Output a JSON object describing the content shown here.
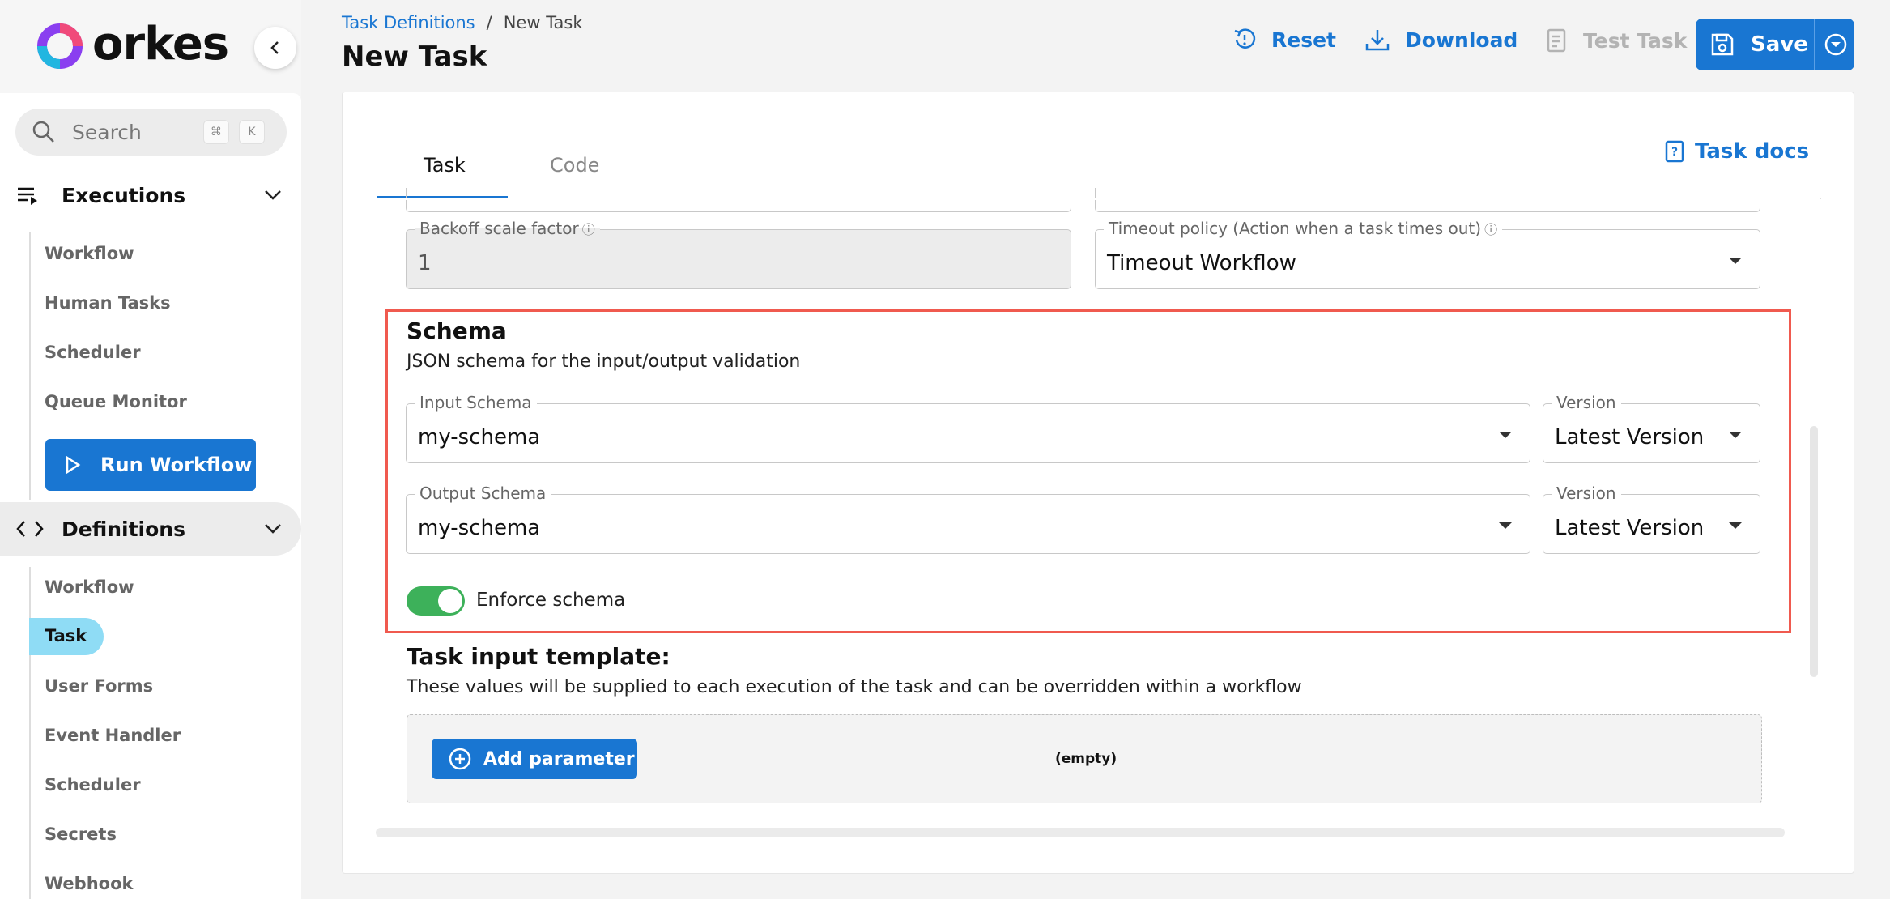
{
  "app": {
    "logo_text": "orkes"
  },
  "sidebar": {
    "search": {
      "placeholder": "Search",
      "kbd_1": "⌘",
      "kbd_2": "K"
    },
    "executions": {
      "label": "Executions",
      "items": [
        "Workflow",
        "Human Tasks",
        "Scheduler",
        "Queue Monitor"
      ]
    },
    "run_workflow_label": "Run Workflow",
    "definitions": {
      "label": "Definitions",
      "items": [
        "Workflow",
        "Task",
        "User Forms",
        "Event Handler",
        "Scheduler",
        "Secrets",
        "Webhook"
      ],
      "active": "Task"
    }
  },
  "header": {
    "breadcrumb_parent": "Task Definitions",
    "breadcrumb_sep": "/",
    "breadcrumb_current": "New Task",
    "title": "New Task",
    "reset_label": "Reset",
    "download_label": "Download",
    "test_task_label": "Test Task",
    "save_label": "Save"
  },
  "tabs": {
    "task": "Task",
    "code": "Code",
    "active": "Task"
  },
  "task_docs_label": "Task docs",
  "fields": {
    "backoff": {
      "label": "Backoff scale factor",
      "value": "1"
    },
    "timeout_policy": {
      "label": "Timeout policy (Action when a task times out)",
      "value": "Timeout Workflow"
    }
  },
  "schema": {
    "title": "Schema",
    "subtitle": "JSON schema for the input/output validation",
    "input_schema": {
      "label": "Input Schema",
      "value": "my-schema"
    },
    "input_version": {
      "label": "Version",
      "value": "Latest Version"
    },
    "output_schema": {
      "label": "Output Schema",
      "value": "my-schema"
    },
    "output_version": {
      "label": "Version",
      "value": "Latest Version"
    },
    "enforce_label": "Enforce schema",
    "enforce_on": true
  },
  "task_input_template": {
    "title": "Task input template:",
    "subtitle": "These values will be supplied to each execution of the task and can be overridden within a workflow",
    "add_parameter_label": "Add parameter",
    "empty_label": "(empty)"
  },
  "colors": {
    "accent": "#1976d2",
    "highlight_border": "#f05a4f",
    "toggle_on": "#3db15a",
    "active_pill": "#8fdcf5"
  }
}
